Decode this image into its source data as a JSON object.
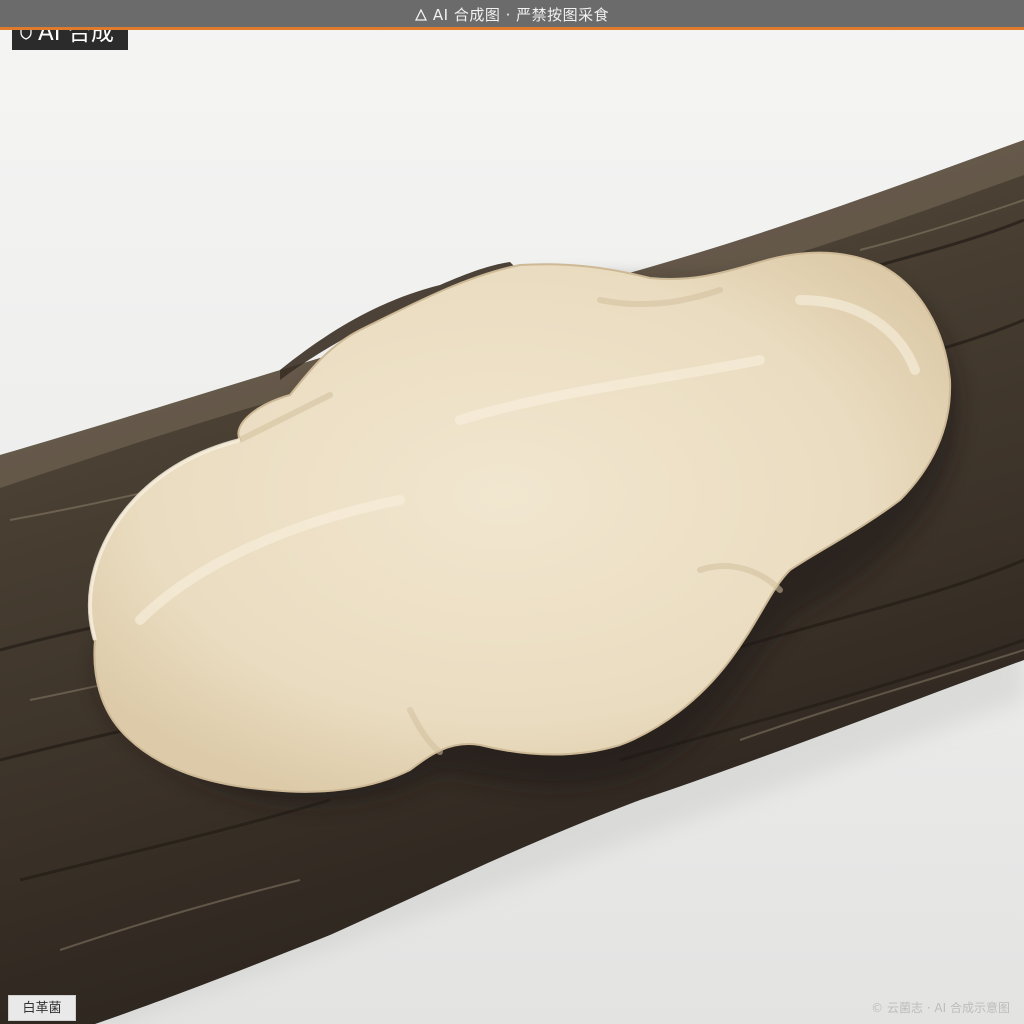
{
  "banner": {
    "icon": "warning-icon",
    "text": "AI 合成图 · 严禁按图采食"
  },
  "badge": {
    "icon": "shield-icon",
    "text": "AI 合成"
  },
  "species_label": "白革菌",
  "credit": "© 云菌志 · AI 合成示意图",
  "colors": {
    "banner_bg": "#6b6b6b",
    "banner_accent": "#e07a2c",
    "backdrop": "#f1f1f0",
    "log_bark": "#3e352b",
    "fungus_cap": "#ece0c6"
  }
}
